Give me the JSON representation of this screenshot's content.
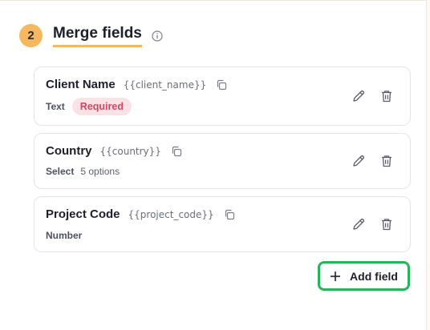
{
  "section": {
    "step_number": "2",
    "title": "Merge fields"
  },
  "fields": [
    {
      "name": "Client Name",
      "token": "{{client_name}}",
      "type": "Text",
      "badge": "Required",
      "options": ""
    },
    {
      "name": "Country",
      "token": "{{country}}",
      "type": "Select",
      "badge": "",
      "options": "5 options"
    },
    {
      "name": "Project Code",
      "token": "{{project_code}}",
      "type": "Number",
      "badge": "",
      "options": ""
    }
  ],
  "add_button": {
    "label": "Add field"
  },
  "icons": {
    "info": "info-icon",
    "copy": "copy-icon",
    "edit": "pencil-icon",
    "delete": "trash-icon",
    "add": "plus-icon"
  },
  "colors": {
    "step_badge": "#f5b860",
    "required_bg": "#fbe2e7",
    "required_text": "#d14763",
    "add_button_border": "#25b45a"
  }
}
